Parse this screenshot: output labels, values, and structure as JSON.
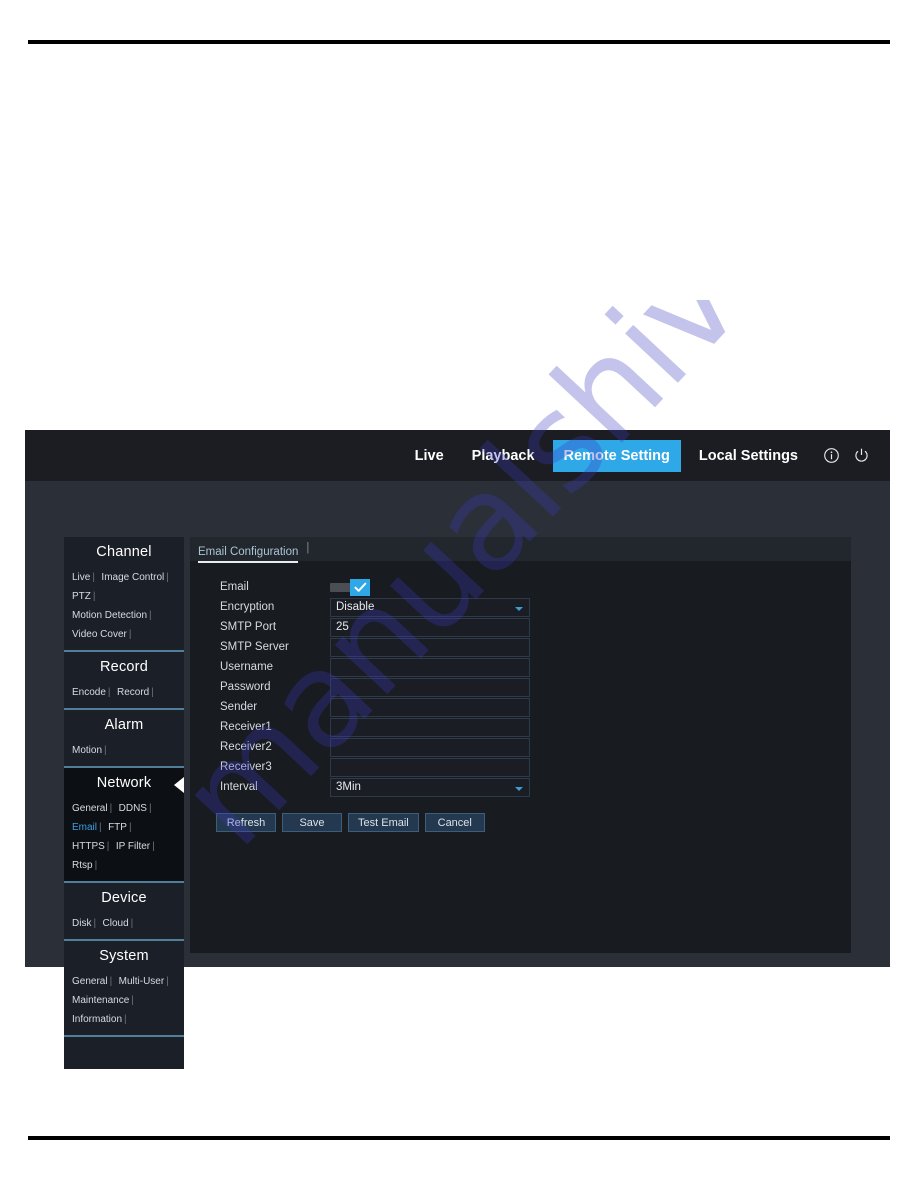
{
  "document": {
    "rule_top": "",
    "rule_bottom": "",
    "watermark": "manualshive.com"
  },
  "nav": {
    "items": [
      {
        "label": "Live",
        "active": false
      },
      {
        "label": "Playback",
        "active": false
      },
      {
        "label": "Remote Setting",
        "active": true
      },
      {
        "label": "Local Settings",
        "active": false
      }
    ],
    "icons": [
      {
        "name": "info-icon"
      },
      {
        "name": "power-icon"
      }
    ],
    "active_color": "#2fa8e8"
  },
  "sidebar": {
    "sections": [
      {
        "title": "Channel",
        "active": false,
        "links": [
          {
            "label": "Live",
            "highlight": false
          },
          {
            "label": "Image Control",
            "highlight": false
          },
          {
            "label": "PTZ",
            "highlight": false
          },
          {
            "label": "Motion Detection",
            "highlight": false
          },
          {
            "label": "Video Cover",
            "highlight": false
          }
        ]
      },
      {
        "title": "Record",
        "active": false,
        "links": [
          {
            "label": "Encode",
            "highlight": false
          },
          {
            "label": "Record",
            "highlight": false
          }
        ]
      },
      {
        "title": "Alarm",
        "active": false,
        "links": [
          {
            "label": "Motion",
            "highlight": false
          }
        ]
      },
      {
        "title": "Network",
        "active": true,
        "links": [
          {
            "label": "General",
            "highlight": false
          },
          {
            "label": "DDNS",
            "highlight": false
          },
          {
            "label": "Email",
            "highlight": true
          },
          {
            "label": "FTP",
            "highlight": false
          },
          {
            "label": "HTTPS",
            "highlight": false
          },
          {
            "label": "IP Filter",
            "highlight": false
          },
          {
            "label": "Rtsp",
            "highlight": false
          }
        ]
      },
      {
        "title": "Device",
        "active": false,
        "links": [
          {
            "label": "Disk",
            "highlight": false
          },
          {
            "label": "Cloud",
            "highlight": false
          }
        ]
      },
      {
        "title": "System",
        "active": false,
        "links": [
          {
            "label": "General",
            "highlight": false
          },
          {
            "label": "Multi-User",
            "highlight": false
          },
          {
            "label": "Maintenance",
            "highlight": false
          },
          {
            "label": "Information",
            "highlight": false
          }
        ]
      }
    ],
    "separator": "|"
  },
  "panel": {
    "tab_label": "Email Configuration",
    "tab_separator": "|",
    "fields": [
      {
        "label": "Email",
        "type": "toggle",
        "value": "on"
      },
      {
        "label": "Encryption",
        "type": "select",
        "value": "Disable"
      },
      {
        "label": "SMTP Port",
        "type": "text",
        "value": "25"
      },
      {
        "label": "SMTP Server",
        "type": "text",
        "value": ""
      },
      {
        "label": "Username",
        "type": "text",
        "value": ""
      },
      {
        "label": "Password",
        "type": "text",
        "value": ""
      },
      {
        "label": "Sender",
        "type": "text",
        "value": ""
      },
      {
        "label": "Receiver1",
        "type": "text",
        "value": ""
      },
      {
        "label": "Receiver2",
        "type": "text",
        "value": ""
      },
      {
        "label": "Receiver3",
        "type": "text",
        "value": ""
      },
      {
        "label": "Interval",
        "type": "select",
        "value": "3Min"
      }
    ],
    "buttons": [
      {
        "label": "Refresh"
      },
      {
        "label": "Save"
      },
      {
        "label": "Test Email"
      },
      {
        "label": "Cancel"
      }
    ]
  }
}
